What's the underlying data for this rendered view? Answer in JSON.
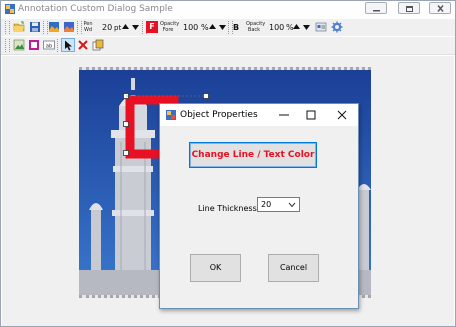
{
  "window": {
    "title": "Annotation Custom Dialog Sample",
    "controls": [
      "minimize",
      "restore",
      "close"
    ]
  },
  "toolbar": {
    "pen_width": {
      "label_line1": "Pen",
      "label_line2": "Wd",
      "value": "20",
      "unit": "pt"
    },
    "opacity_fore": {
      "label_line1": "Opacity",
      "label_line2": "Fore",
      "value": "100",
      "unit": "%"
    },
    "opacity_back": {
      "label_line1": "Opacity",
      "label_line2": "Back",
      "value": "100",
      "unit": "%"
    },
    "font_color_glyph": "F",
    "bold_glyph": "B",
    "icons_row1": [
      "open-folder-icon",
      "save-icon",
      "image-icon",
      "image-save-icon",
      "font-color-icon",
      "bold-icon",
      "properties-icon",
      "settings-gear-icon"
    ],
    "icons_row2": [
      "picture-icon",
      "rectangle-tool-icon",
      "text-box-icon",
      "select-pointer-icon",
      "delete-icon",
      "copy-icon"
    ]
  },
  "dialog": {
    "title": "Object Properties",
    "change_color_button": "Change Line / Text Color",
    "thickness_label": "Line Thickness",
    "thickness_value": "20",
    "ok_button": "OK",
    "cancel_button": "Cancel"
  },
  "colors": {
    "accent_red": "#e81123",
    "focus_blue": "#0078d7",
    "sky_blue": "#1d4fa8"
  }
}
